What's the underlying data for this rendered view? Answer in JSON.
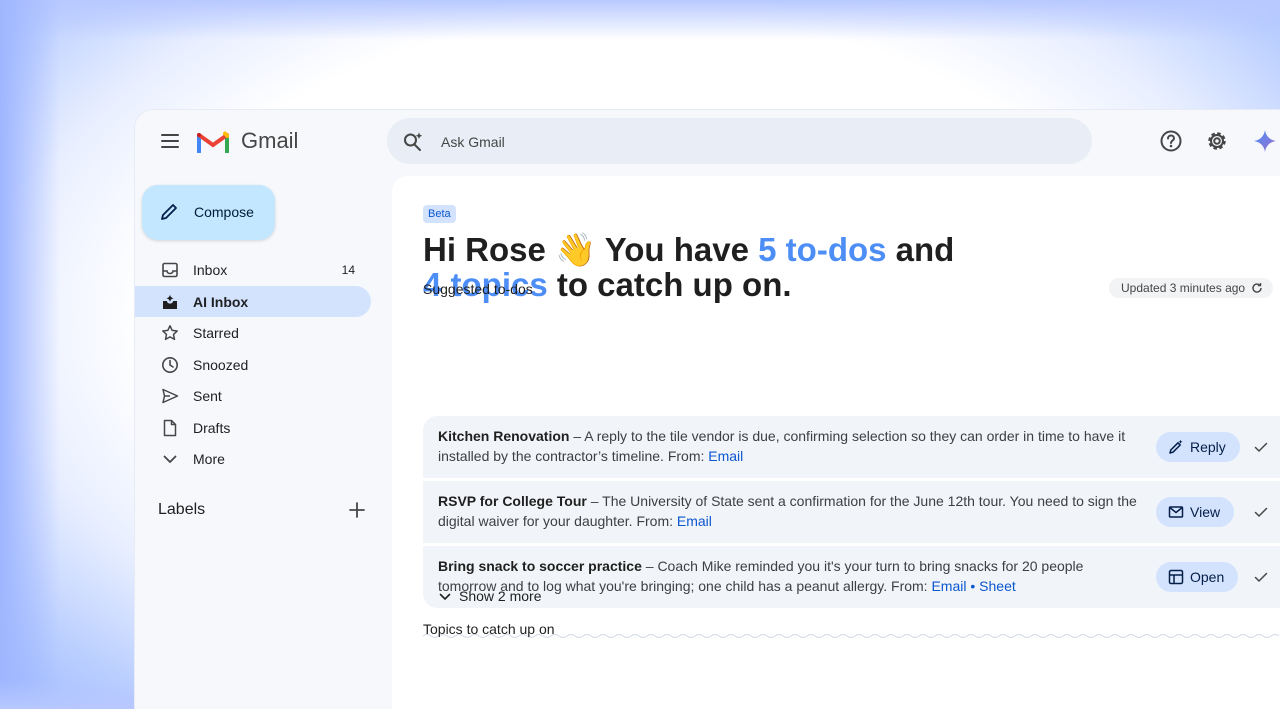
{
  "app": {
    "name": "Gmail"
  },
  "search": {
    "placeholder": "Ask Gmail"
  },
  "sidebar": {
    "compose_label": "Compose",
    "items": [
      {
        "label": "Inbox",
        "count": "14"
      },
      {
        "label": "AI Inbox",
        "count": ""
      },
      {
        "label": "Starred",
        "count": ""
      },
      {
        "label": "Snoozed",
        "count": ""
      },
      {
        "label": "Sent",
        "count": ""
      },
      {
        "label": "Drafts",
        "count": ""
      },
      {
        "label": "More",
        "count": ""
      }
    ],
    "labels_title": "Labels"
  },
  "main": {
    "badge": "Beta",
    "greeting": {
      "p1": "Hi Rose ",
      "emoji": "👋",
      "p2": " You have ",
      "todos": "5 to-dos",
      "p3": " and",
      "topics": "4 topics",
      "p4": " to catch up on."
    },
    "updated": "Updated 3 minutes ago",
    "todos_title": "Suggested to-dos",
    "todos": [
      {
        "title": "Kitchen Renovation",
        "text": " – A reply to the tile vendor is due, confirming selection so they can order in time to have it installed by the contractor’s timeline.  From: ",
        "link1": "Email",
        "sep": "",
        "link2": "",
        "action": "Reply"
      },
      {
        "title": "RSVP for College Tour",
        "text": " – The University of State sent a confirmation for the June 12th tour. You need to sign the digital waiver for your daughter.  From: ",
        "link1": "Email",
        "sep": "",
        "link2": "",
        "action": "View"
      },
      {
        "title": "Bring snack to soccer practice",
        "text": " – Coach Mike reminded you it's your turn to bring snacks for 20 people tomorrow and to log what you're bringing; one child has a peanut allergy.  From: ",
        "link1": "Email",
        "sep": " • ",
        "link2": "Sheet",
        "action": "Open"
      }
    ],
    "show_more": "Show 2 more",
    "topics_title": "Topics to catch up on"
  },
  "colors": {
    "accent": "#4c8df6",
    "compose_bg": "#c2e7ff",
    "active_nav": "#d3e3fd",
    "link": "#0b57d0"
  }
}
